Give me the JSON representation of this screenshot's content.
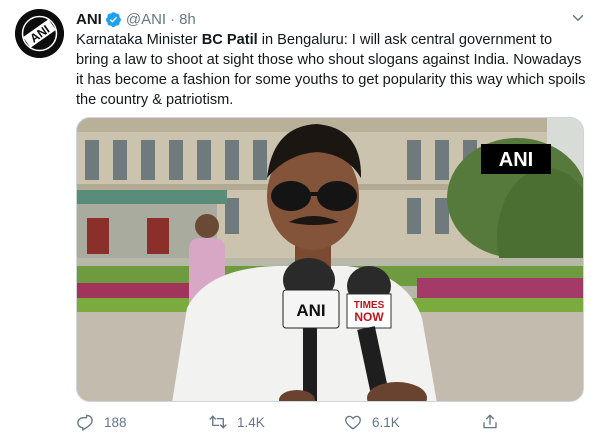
{
  "tweet": {
    "author_name": "ANI",
    "handle": "@ANI",
    "separator": "·",
    "time": "8h",
    "text_prefix": "Karnataka Minister ",
    "text_bold": "BC Patil",
    "text_suffix": " in Bengaluru: I will ask central government to bring a law to shoot at sight those who shout slogans against India. Nowadays it has become a fashion for some youths to get popularity this way which spoils the country & patriotism.",
    "avatar_text": "ANI",
    "media": {
      "watermark": "ANI",
      "mic1_label": "ANI",
      "mic2_label_line1": "TIMES",
      "mic2_label_line2": "NOW"
    }
  },
  "actions": {
    "reply_count": "188",
    "retweet_count": "1.4K",
    "like_count": "6.1K"
  },
  "icons": {
    "verified": "verified-badge-icon",
    "more": "chevron-down-icon",
    "reply": "reply-icon",
    "retweet": "retweet-icon",
    "like": "heart-icon",
    "share": "share-icon"
  },
  "colors": {
    "accent": "#1da1f2",
    "secondary_text": "#657786",
    "primary_text": "#14171a"
  }
}
